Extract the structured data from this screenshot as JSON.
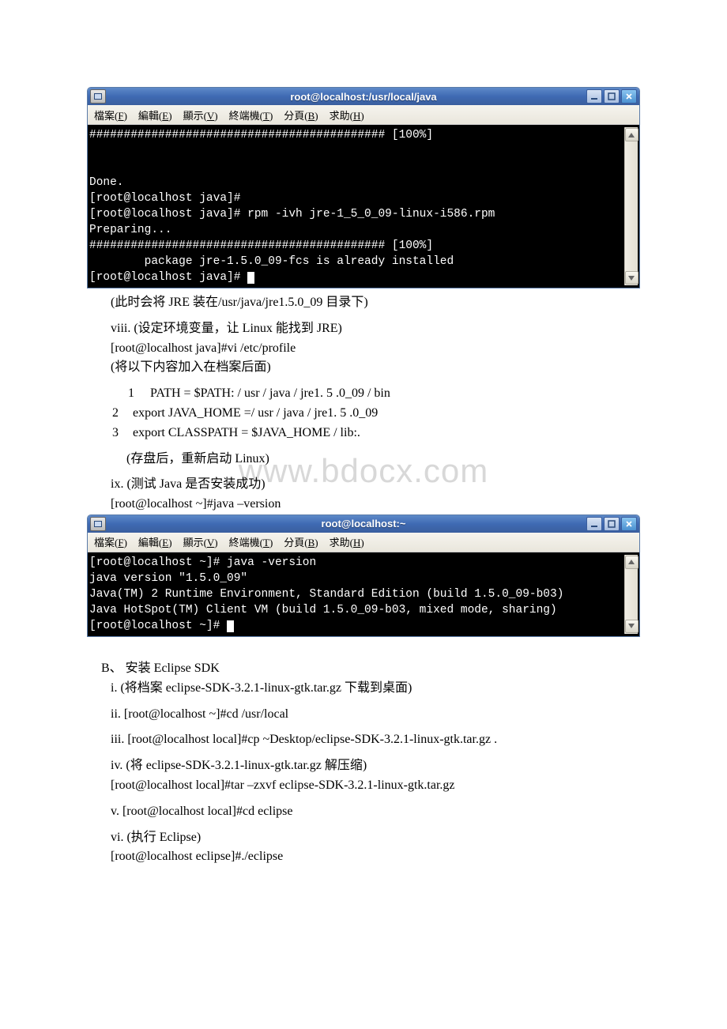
{
  "term1": {
    "title": "root@localhost:/usr/local/java",
    "menu": [
      "檔案(F)",
      "編輯(E)",
      "顯示(V)",
      "終端機(T)",
      "分頁(B)",
      "求助(H)"
    ],
    "lines": [
      "########################################### [100%]",
      "",
      "",
      "Done.",
      "[root@localhost java]#",
      "[root@localhost java]# rpm -ivh jre-1_5_0_09-linux-i586.rpm",
      "Preparing...",
      "########################################### [100%]",
      "        package jre-1.5.0_09-fcs is already installed",
      "[root@localhost java]# "
    ]
  },
  "term2": {
    "title": "root@localhost:~",
    "menu": [
      "檔案(F)",
      "編輯(E)",
      "顯示(V)",
      "終端機(T)",
      "分頁(B)",
      "求助(H)"
    ],
    "lines": [
      "[root@localhost ~]# java -version",
      "java version \"1.5.0_09\"",
      "Java(TM) 2 Runtime Environment, Standard Edition (build 1.5.0_09-b03)",
      "Java HotSpot(TM) Client VM (build 1.5.0_09-b03, mixed mode, sharing)",
      "[root@localhost ~]# ",
      ""
    ]
  },
  "doc": {
    "p1": "(此时会将 JRE 装在/usr/java/jre1.5.0_09 目录下)",
    "p2": "viii. (设定环境变量，让 Linux 能找到 JRE)",
    "p3": "[root@localhost java]#vi /etc/profile",
    "p4": "(将以下内容加入在档案后面)",
    "l1n": "1",
    "l1": "PATH = $PATH: / usr / java / jre1. 5 .0_09 / bin",
    "l2n": "2",
    "l2": "export JAVA_HOME =/ usr / java / jre1. 5 .0_09",
    "l3n": "3",
    "l3": "export CLASSPATH = $JAVA_HOME / lib:.",
    "p5": "(存盘后，重新启动 Linux)",
    "p6": "ix. (测试 Java 是否安装成功)",
    "p7": "[root@localhost ~]#java –version",
    "wm": "www.bdocx.com",
    "secB": "B、 安装 Eclipse SDK",
    "b1": "i. (将档案 eclipse-SDK-3.2.1-linux-gtk.tar.gz 下载到桌面)",
    "b2": "ii. [root@localhost ~]#cd /usr/local",
    "b3": "iii. [root@localhost local]#cp ~Desktop/eclipse-SDK-3.2.1-linux-gtk.tar.gz .",
    "b4a": "iv. (将 eclipse-SDK-3.2.1-linux-gtk.tar.gz 解压缩)",
    "b4b": "[root@localhost local]#tar –zxvf eclipse-SDK-3.2.1-linux-gtk.tar.gz",
    "b5": "v. [root@localhost local]#cd eclipse",
    "b6a": "vi. (执行 Eclipse)",
    "b6b": "[root@localhost eclipse]#./eclipse"
  }
}
